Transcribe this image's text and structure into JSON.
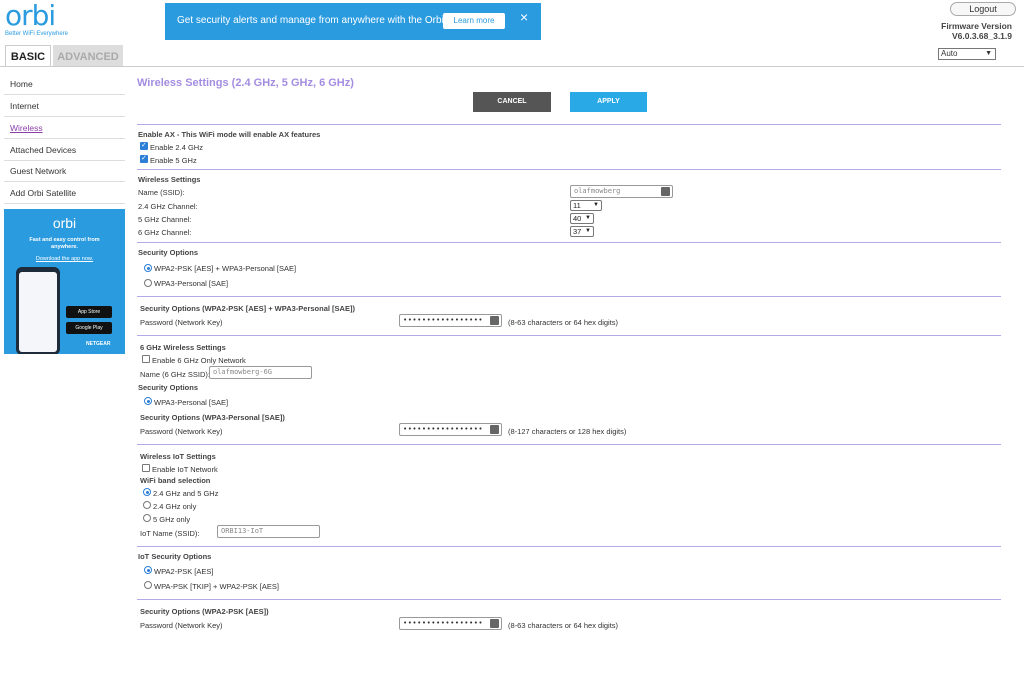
{
  "header": {
    "logo_word": "orbi",
    "logo_tagline": "Better WiFi Everywhere",
    "banner_text": "Get security alerts and manage from anywhere with the Orbi App.",
    "banner_learn_more": "Learn more",
    "banner_close": "×",
    "logout_label": "Logout",
    "firmware_label": "Firmware Version",
    "firmware_value": "V6.0.3.68_3.1.9",
    "language_value": "Auto"
  },
  "tabs": {
    "basic": "BASIC",
    "advanced": "ADVANCED"
  },
  "sidebar": {
    "items": [
      {
        "label": "Home"
      },
      {
        "label": "Internet"
      },
      {
        "label": "Wireless"
      },
      {
        "label": "Attached Devices"
      },
      {
        "label": "Guest Network"
      },
      {
        "label": "Add Orbi Satellite"
      }
    ],
    "promo": {
      "logo": "orbi",
      "line1": "Fast and easy control from",
      "line2": "anywhere.",
      "link": "Download the app now.",
      "app_store": "App Store",
      "google_play": "Google Play",
      "brand": "NETGEAR"
    }
  },
  "page": {
    "title": "Wireless Settings (2.4 GHz, 5 GHz, 6 GHz)",
    "cancel": "CANCEL",
    "apply": "APPLY"
  },
  "ax": {
    "header": "Enable AX - This WiFi mode will enable AX features",
    "enable24": "Enable 2.4 GHz",
    "enable5": "Enable 5 GHz"
  },
  "wireless": {
    "header": "Wireless Settings",
    "ssid_label": "Name (SSID):",
    "ssid_value": "olafmowberg",
    "ch24_label": "2.4 GHz Channel:",
    "ch24_value": "11",
    "ch5_label": "5 GHz Channel:",
    "ch5_value": "40",
    "ch6_label": "6 GHz Channel:",
    "ch6_value": "37"
  },
  "security": {
    "header": "Security Options",
    "opt1": "WPA2-PSK [AES] + WPA3-Personal [SAE]",
    "opt2": "WPA3-Personal [SAE]"
  },
  "security_detail": {
    "header": "Security Options (WPA2-PSK [AES] + WPA3-Personal [SAE])",
    "pw_label": "Password (Network Key)",
    "pw_value": "•••••••••••••••••",
    "hint": "(8-63 characters or 64 hex digits)"
  },
  "ghz6": {
    "header": "6 GHz Wireless Settings",
    "enable_only": "Enable 6 GHz Only Network",
    "ssid_label": "Name (6 GHz SSID):",
    "ssid_value": "olafmowberg-6G",
    "sec_header": "Security Options",
    "sec_opt": "WPA3-Personal [SAE]",
    "sec_detail_header": "Security Options (WPA3-Personal [SAE])",
    "pw_label": "Password (Network Key)",
    "pw_value": "•••••••••••••••••",
    "hint": "(8-127 characters or 128 hex digits)"
  },
  "iot": {
    "header": "Wireless IoT Settings",
    "enable": "Enable IoT Network",
    "band_header": "WiFi band selection",
    "band1": "2.4 GHz and 5 GHz",
    "band2": "2.4 GHz only",
    "band3": "5 GHz only",
    "ssid_label": "IoT Name (SSID):",
    "ssid_value": "ORBI13-IoT"
  },
  "iot_security": {
    "header": "IoT Security Options",
    "opt1": "WPA2-PSK [AES]",
    "opt2": "WPA-PSK [TKIP] + WPA2-PSK [AES]",
    "detail_header": "Security Options (WPA2-PSK [AES])",
    "pw_label": "Password (Network Key)",
    "pw_value": "•••••••••••••••••",
    "hint": "(8-63 characters or 64 hex digits)"
  }
}
